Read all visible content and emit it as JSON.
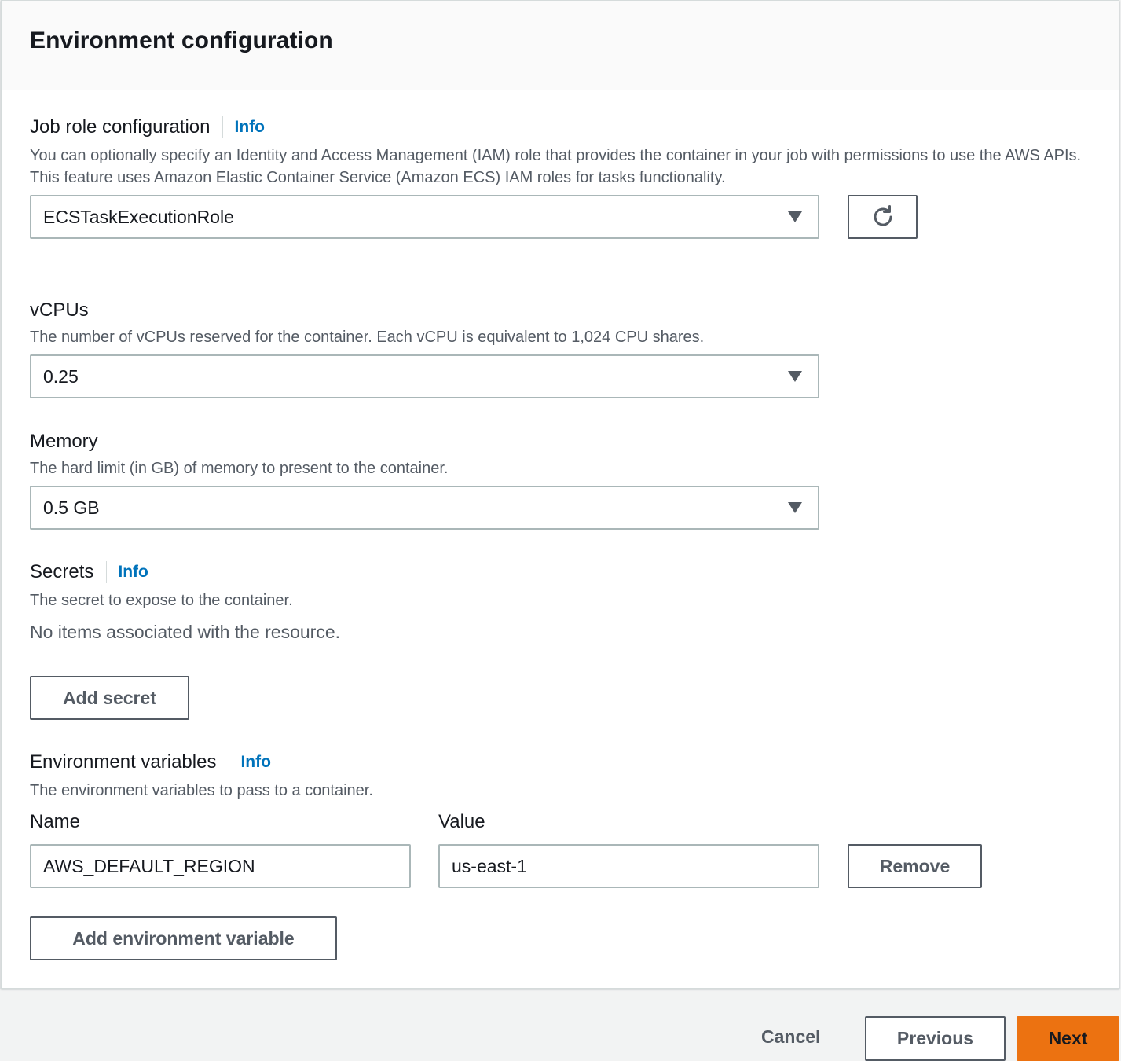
{
  "panel": {
    "title": "Environment configuration"
  },
  "job_role": {
    "label": "Job role configuration",
    "info": "Info",
    "description": "You can optionally specify an Identity and Access Management (IAM) role that provides the container in your job with permissions to use the AWS APIs. This feature uses Amazon Elastic Container Service (Amazon ECS) IAM roles for tasks functionality.",
    "selected": "ECSTaskExecutionRole",
    "refresh_icon": "refresh-icon"
  },
  "vcpus": {
    "label": "vCPUs",
    "description": "The number of vCPUs reserved for the container. Each vCPU is equivalent to 1,024 CPU shares.",
    "selected": "0.25"
  },
  "memory": {
    "label": "Memory",
    "description": "The hard limit (in GB) of memory to present to the container.",
    "selected": "0.5 GB"
  },
  "secrets": {
    "label": "Secrets",
    "info": "Info",
    "description": "The secret to expose to the container.",
    "empty": "No items associated with the resource.",
    "add_button": "Add secret"
  },
  "env_vars": {
    "label": "Environment variables",
    "info": "Info",
    "description": "The environment variables to pass to a container.",
    "name_header": "Name",
    "value_header": "Value",
    "rows": [
      {
        "name": "AWS_DEFAULT_REGION",
        "value": "us-east-1",
        "remove": "Remove"
      }
    ],
    "add_button": "Add environment variable"
  },
  "footer": {
    "cancel": "Cancel",
    "previous": "Previous",
    "next": "Next"
  },
  "colors": {
    "primary": "#ec7211",
    "link": "#0073bb",
    "border": "#aab7b8"
  }
}
